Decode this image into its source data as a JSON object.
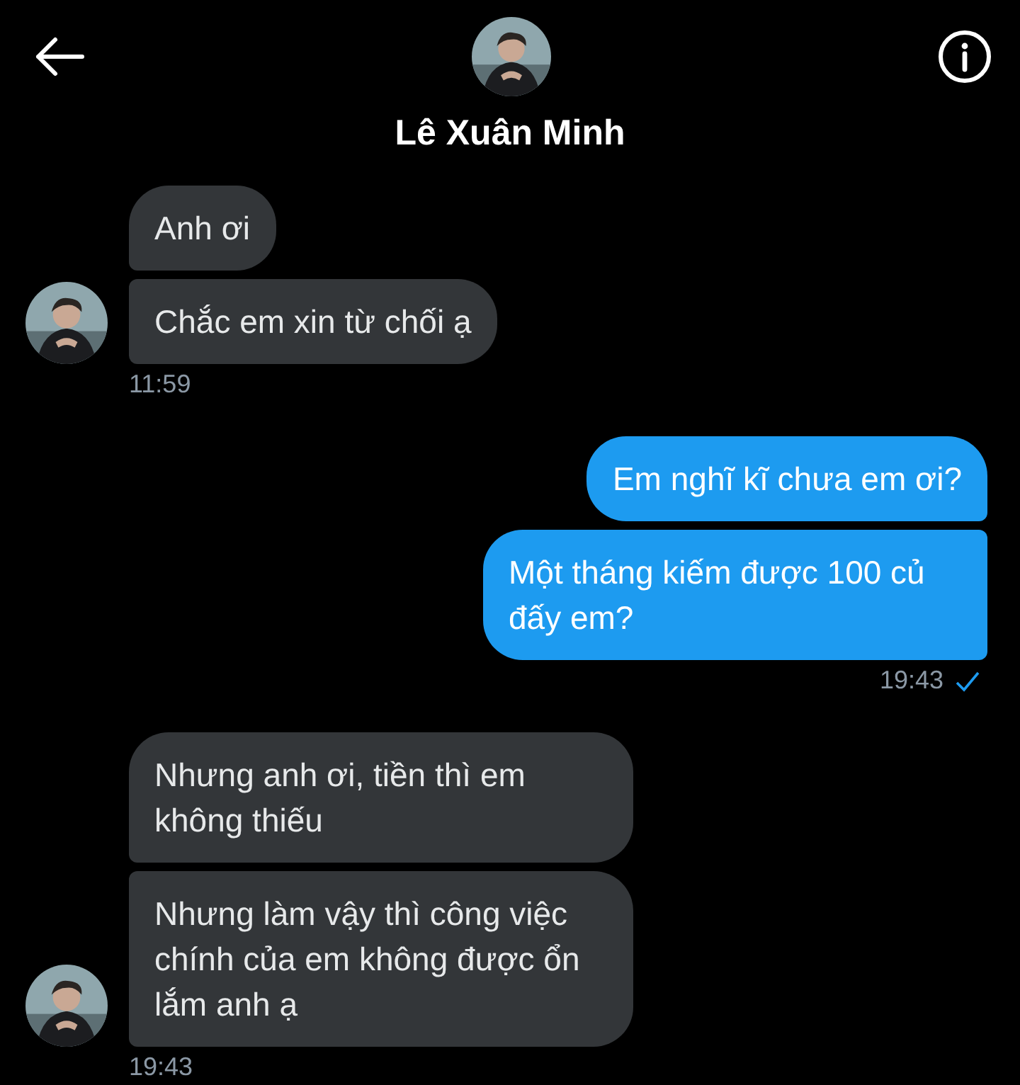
{
  "header": {
    "name": "Lê Xuân Minh"
  },
  "groups": [
    {
      "kind": "incoming",
      "messages": [
        "Anh ơi",
        "Chắc em xin từ chối ạ"
      ],
      "time": "11:59",
      "seen": false
    },
    {
      "kind": "outgoing",
      "messages": [
        "Em nghĩ kĩ chưa em ơi?",
        "Một tháng kiếm được 100 củ đấy em?"
      ],
      "time": "19:43",
      "seen": true
    },
    {
      "kind": "incoming",
      "messages": [
        "Nhưng anh ơi, tiền thì em không thiếu",
        "Nhưng làm vậy thì công việc chính của em không được ổn lắm anh ạ"
      ],
      "time": "19:43",
      "seen": false
    }
  ]
}
